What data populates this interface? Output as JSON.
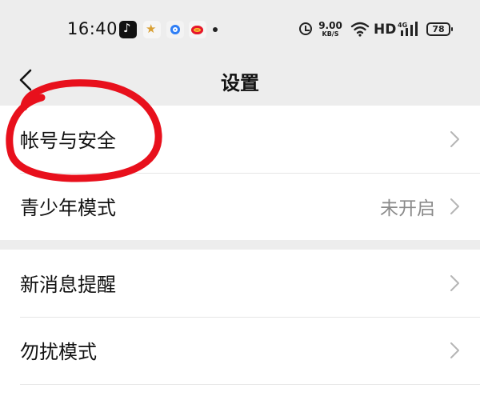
{
  "status_bar": {
    "time": "16:40",
    "net_speed_value": "9.00",
    "net_speed_unit": "KB/S",
    "hd_label": "HD",
    "network_type": "4G",
    "battery": "78"
  },
  "nav": {
    "title": "设置"
  },
  "groups": [
    {
      "items": [
        {
          "label": "帐号与安全",
          "value": ""
        },
        {
          "label": "青少年模式",
          "value": "未开启"
        }
      ]
    },
    {
      "items": [
        {
          "label": "新消息提醒",
          "value": ""
        },
        {
          "label": "勿扰模式",
          "value": ""
        }
      ]
    }
  ],
  "colors": {
    "background": "#ededed",
    "row_background": "#ffffff",
    "annotation_red": "#e8101c",
    "secondary_text": "#8a8a8a"
  }
}
